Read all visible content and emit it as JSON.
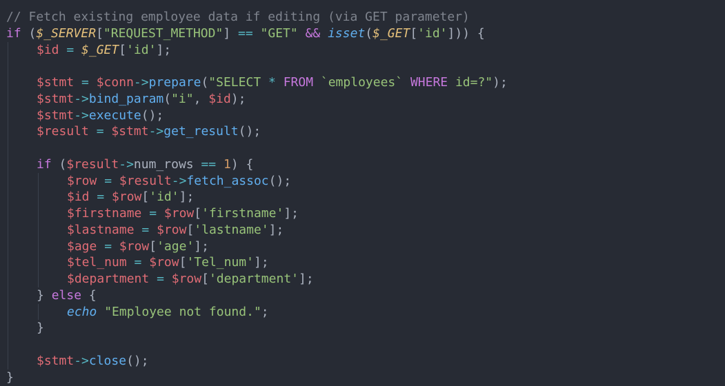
{
  "editor": {
    "language": "php",
    "theme": {
      "background": "#272b34",
      "comment": "#7f848e",
      "keyword": "#c678dd",
      "variable": "#e06c75",
      "superglobal": "#e5c07b",
      "string": "#98c379",
      "function": "#61afef",
      "operator": "#56b6c2",
      "number": "#d19a66",
      "punctuation": "#abb2bf",
      "indent_guide": "#3b414d"
    },
    "lines": [
      {
        "indent": 0,
        "tokens": [
          {
            "t": "cmt",
            "v": "// Fetch existing employee data if editing (via GET parameter)"
          }
        ]
      },
      {
        "indent": 0,
        "tokens": [
          {
            "t": "kw",
            "v": "if"
          },
          {
            "t": "pn",
            "v": " ("
          },
          {
            "t": "sup",
            "v": "$_SERVER"
          },
          {
            "t": "pn",
            "v": "["
          },
          {
            "t": "str",
            "v": "\"REQUEST_METHOD\""
          },
          {
            "t": "pn",
            "v": "] "
          },
          {
            "t": "op",
            "v": "=="
          },
          {
            "t": "pn",
            "v": " "
          },
          {
            "t": "str",
            "v": "\"GET\""
          },
          {
            "t": "pn",
            "v": " "
          },
          {
            "t": "kw",
            "v": "&&"
          },
          {
            "t": "pn",
            "v": " "
          },
          {
            "t": "ifn",
            "v": "isset"
          },
          {
            "t": "pn",
            "v": "("
          },
          {
            "t": "sup",
            "v": "$_GET"
          },
          {
            "t": "pn",
            "v": "["
          },
          {
            "t": "str",
            "v": "'id'"
          },
          {
            "t": "pn",
            "v": "])) {"
          }
        ]
      },
      {
        "indent": 1,
        "tokens": [
          {
            "t": "var",
            "v": "$id"
          },
          {
            "t": "pn",
            "v": " "
          },
          {
            "t": "op",
            "v": "="
          },
          {
            "t": "pn",
            "v": " "
          },
          {
            "t": "sup",
            "v": "$_GET"
          },
          {
            "t": "pn",
            "v": "["
          },
          {
            "t": "str",
            "v": "'id'"
          },
          {
            "t": "pn",
            "v": "];"
          }
        ]
      },
      {
        "indent": 1,
        "tokens": []
      },
      {
        "indent": 1,
        "tokens": [
          {
            "t": "var",
            "v": "$stmt"
          },
          {
            "t": "pn",
            "v": " "
          },
          {
            "t": "op",
            "v": "="
          },
          {
            "t": "pn",
            "v": " "
          },
          {
            "t": "var",
            "v": "$conn"
          },
          {
            "t": "op",
            "v": "->"
          },
          {
            "t": "fn",
            "v": "prepare"
          },
          {
            "t": "pn",
            "v": "("
          },
          {
            "t": "str",
            "v": "\"SELECT "
          },
          {
            "t": "op",
            "v": "*"
          },
          {
            "t": "str",
            "v": " "
          },
          {
            "t": "kw",
            "v": "FROM"
          },
          {
            "t": "str",
            "v": " `employees` "
          },
          {
            "t": "kw",
            "v": "WHERE"
          },
          {
            "t": "str",
            "v": " id=?\""
          },
          {
            "t": "pn",
            "v": ");"
          }
        ]
      },
      {
        "indent": 1,
        "tokens": [
          {
            "t": "var",
            "v": "$stmt"
          },
          {
            "t": "op",
            "v": "->"
          },
          {
            "t": "fn",
            "v": "bind_param"
          },
          {
            "t": "pn",
            "v": "("
          },
          {
            "t": "str",
            "v": "\"i\""
          },
          {
            "t": "pn",
            "v": ", "
          },
          {
            "t": "var",
            "v": "$id"
          },
          {
            "t": "pn",
            "v": ");"
          }
        ]
      },
      {
        "indent": 1,
        "tokens": [
          {
            "t": "var",
            "v": "$stmt"
          },
          {
            "t": "op",
            "v": "->"
          },
          {
            "t": "fn",
            "v": "execute"
          },
          {
            "t": "pn",
            "v": "();"
          }
        ]
      },
      {
        "indent": 1,
        "tokens": [
          {
            "t": "var",
            "v": "$result"
          },
          {
            "t": "pn",
            "v": " "
          },
          {
            "t": "op",
            "v": "="
          },
          {
            "t": "pn",
            "v": " "
          },
          {
            "t": "var",
            "v": "$stmt"
          },
          {
            "t": "op",
            "v": "->"
          },
          {
            "t": "fn",
            "v": "get_result"
          },
          {
            "t": "pn",
            "v": "();"
          }
        ]
      },
      {
        "indent": 1,
        "tokens": []
      },
      {
        "indent": 1,
        "tokens": [
          {
            "t": "kw",
            "v": "if"
          },
          {
            "t": "pn",
            "v": " ("
          },
          {
            "t": "var",
            "v": "$result"
          },
          {
            "t": "op",
            "v": "->"
          },
          {
            "t": "prop",
            "v": "num_rows"
          },
          {
            "t": "pn",
            "v": " "
          },
          {
            "t": "op",
            "v": "=="
          },
          {
            "t": "pn",
            "v": " "
          },
          {
            "t": "num",
            "v": "1"
          },
          {
            "t": "pn",
            "v": ") {"
          }
        ]
      },
      {
        "indent": 2,
        "tokens": [
          {
            "t": "var",
            "v": "$row"
          },
          {
            "t": "pn",
            "v": " "
          },
          {
            "t": "op",
            "v": "="
          },
          {
            "t": "pn",
            "v": " "
          },
          {
            "t": "var",
            "v": "$result"
          },
          {
            "t": "op",
            "v": "->"
          },
          {
            "t": "fn",
            "v": "fetch_assoc"
          },
          {
            "t": "pn",
            "v": "();"
          }
        ]
      },
      {
        "indent": 2,
        "tokens": [
          {
            "t": "var",
            "v": "$id"
          },
          {
            "t": "pn",
            "v": " "
          },
          {
            "t": "op",
            "v": "="
          },
          {
            "t": "pn",
            "v": " "
          },
          {
            "t": "var",
            "v": "$row"
          },
          {
            "t": "pn",
            "v": "["
          },
          {
            "t": "str",
            "v": "'id'"
          },
          {
            "t": "pn",
            "v": "];"
          }
        ]
      },
      {
        "indent": 2,
        "tokens": [
          {
            "t": "var",
            "v": "$firstname"
          },
          {
            "t": "pn",
            "v": " "
          },
          {
            "t": "op",
            "v": "="
          },
          {
            "t": "pn",
            "v": " "
          },
          {
            "t": "var",
            "v": "$row"
          },
          {
            "t": "pn",
            "v": "["
          },
          {
            "t": "str",
            "v": "'firstname'"
          },
          {
            "t": "pn",
            "v": "];"
          }
        ]
      },
      {
        "indent": 2,
        "tokens": [
          {
            "t": "var",
            "v": "$lastname"
          },
          {
            "t": "pn",
            "v": " "
          },
          {
            "t": "op",
            "v": "="
          },
          {
            "t": "pn",
            "v": " "
          },
          {
            "t": "var",
            "v": "$row"
          },
          {
            "t": "pn",
            "v": "["
          },
          {
            "t": "str",
            "v": "'lastname'"
          },
          {
            "t": "pn",
            "v": "];"
          }
        ]
      },
      {
        "indent": 2,
        "tokens": [
          {
            "t": "var",
            "v": "$age"
          },
          {
            "t": "pn",
            "v": " "
          },
          {
            "t": "op",
            "v": "="
          },
          {
            "t": "pn",
            "v": " "
          },
          {
            "t": "var",
            "v": "$row"
          },
          {
            "t": "pn",
            "v": "["
          },
          {
            "t": "str",
            "v": "'age'"
          },
          {
            "t": "pn",
            "v": "];"
          }
        ]
      },
      {
        "indent": 2,
        "tokens": [
          {
            "t": "var",
            "v": "$tel_num"
          },
          {
            "t": "pn",
            "v": " "
          },
          {
            "t": "op",
            "v": "="
          },
          {
            "t": "pn",
            "v": " "
          },
          {
            "t": "var",
            "v": "$row"
          },
          {
            "t": "pn",
            "v": "["
          },
          {
            "t": "str",
            "v": "'Tel_num'"
          },
          {
            "t": "pn",
            "v": "];"
          }
        ]
      },
      {
        "indent": 2,
        "tokens": [
          {
            "t": "var",
            "v": "$department"
          },
          {
            "t": "pn",
            "v": " "
          },
          {
            "t": "op",
            "v": "="
          },
          {
            "t": "pn",
            "v": " "
          },
          {
            "t": "var",
            "v": "$row"
          },
          {
            "t": "pn",
            "v": "["
          },
          {
            "t": "str",
            "v": "'department'"
          },
          {
            "t": "pn",
            "v": "];"
          }
        ]
      },
      {
        "indent": 1,
        "tokens": [
          {
            "t": "pn",
            "v": "} "
          },
          {
            "t": "kw",
            "v": "else"
          },
          {
            "t": "pn",
            "v": " {"
          }
        ]
      },
      {
        "indent": 2,
        "tokens": [
          {
            "t": "ifn",
            "v": "echo"
          },
          {
            "t": "pn",
            "v": " "
          },
          {
            "t": "str",
            "v": "\"Employee not found.\""
          },
          {
            "t": "pn",
            "v": ";"
          }
        ]
      },
      {
        "indent": 1,
        "tokens": [
          {
            "t": "pn",
            "v": "}"
          }
        ]
      },
      {
        "indent": 1,
        "tokens": []
      },
      {
        "indent": 1,
        "tokens": [
          {
            "t": "var",
            "v": "$stmt"
          },
          {
            "t": "op",
            "v": "->"
          },
          {
            "t": "fn",
            "v": "close"
          },
          {
            "t": "pn",
            "v": "();"
          }
        ]
      },
      {
        "indent": 0,
        "tokens": [
          {
            "t": "pn",
            "v": "}"
          }
        ]
      }
    ]
  }
}
